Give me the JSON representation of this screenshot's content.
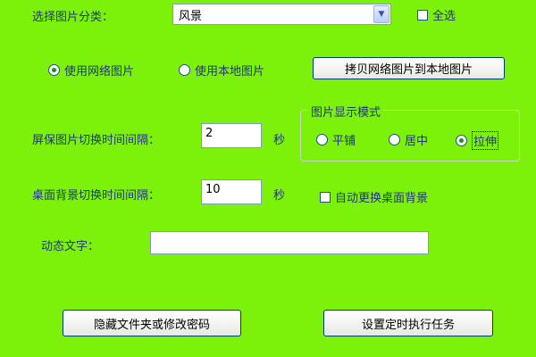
{
  "category": {
    "label": "选择图片分类：",
    "selected": "风景",
    "select_all_label": "全选"
  },
  "source": {
    "options": [
      {
        "label": "使用网络图片",
        "selected": true
      },
      {
        "label": "使用本地图片",
        "selected": false
      }
    ],
    "copy_button_label": "拷贝网络图片到本地图片"
  },
  "screensaver": {
    "label": "屏保图片切换时间间隔：",
    "value": "2",
    "unit": "秒"
  },
  "display_mode": {
    "title": "图片显示模式",
    "options": [
      {
        "label": "平铺",
        "selected": false
      },
      {
        "label": "居中",
        "selected": false
      },
      {
        "label": "拉伸",
        "selected": true
      }
    ]
  },
  "desktop": {
    "label": "桌面背景切换时间间隔：",
    "value": "10",
    "unit": "秒",
    "auto_change_label": "自动更换桌面背景"
  },
  "dynamic_text": {
    "label": "动态文字：",
    "value": ""
  },
  "buttons": {
    "hide_folder": "隐藏文件夹或修改密码",
    "schedule_task": "设置定时执行任务"
  },
  "colors": {
    "background": "#7cf20a",
    "label_text": "#22357a"
  }
}
